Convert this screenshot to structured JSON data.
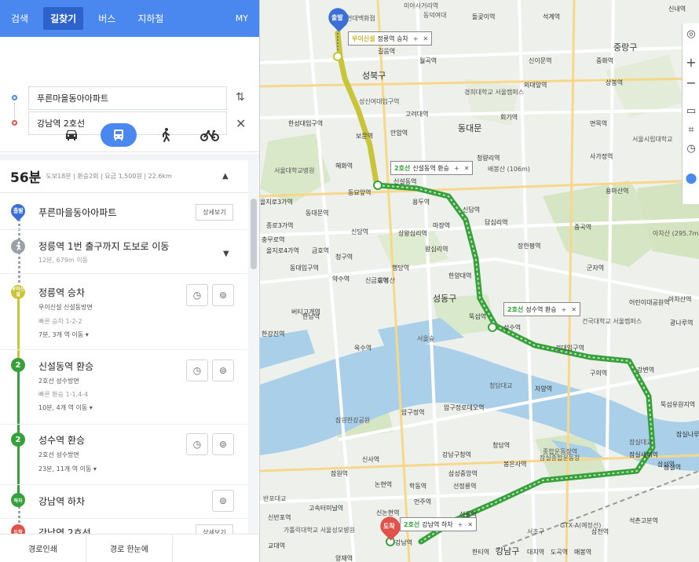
{
  "nav": {
    "tabs": [
      {
        "label": "검색"
      },
      {
        "label": "길찾기"
      },
      {
        "label": "버스"
      },
      {
        "label": "지하철"
      },
      {
        "label": "MY"
      }
    ],
    "active_tab": "길찾기"
  },
  "route_input": {
    "origin": "푸른마을동아아파트",
    "destination": "강남역 2호선",
    "swap_icon": "swap-icon",
    "clear_icon": "close-icon"
  },
  "transport_modes": [
    "car-icon",
    "bus-icon",
    "walk-icon",
    "bike-icon"
  ],
  "active_mode": "bus-icon",
  "summary": {
    "time": "56분",
    "detail": "도보18분 | 환승2회 | 요금 1,500원 | 22.6km"
  },
  "steps": [
    {
      "marker": "출발",
      "title": "푸른마을동아아파트",
      "detail_button": "상세보기"
    },
    {
      "title": "정릉역 1번 출구까지 도보로 이동",
      "sub": "12분, 679m 이동"
    },
    {
      "marker": "우이신설",
      "title": "정릉역 승차",
      "line": "우이신설 신설동방면",
      "car": "빠른 승차 1-2-2",
      "duration": "7분, 3개 역 이동 ▾"
    },
    {
      "marker": "2",
      "title": "신설동역 환승",
      "line": "2호선 성수방면",
      "car": "빠른 환승 1-1,4-4",
      "duration": "10분, 4개 역 이동 ▾"
    },
    {
      "marker": "2",
      "title": "성수역 환승",
      "line": "2호선 성수방면",
      "duration": "23분, 11개 역 이동 ▾"
    },
    {
      "marker": "하차",
      "title": "강남역 하차"
    },
    {
      "marker": "도착",
      "title": "강남역 2호선",
      "detail_button": "상세보기"
    }
  ],
  "footer": {
    "print": "경로인쇄",
    "guide": "경로 한눈에"
  },
  "colors": {
    "brand_blue": "#4a87ee",
    "line_yellow": "#c9c53b",
    "line_green": "#36a13b",
    "origin_pin": "#3b6fd8",
    "dest_pin": "#e0534a"
  },
  "map": {
    "pins": [
      {
        "label": "출발"
      },
      {
        "label": "도착"
      }
    ],
    "route_tags": [
      {
        "line": "우이신설",
        "text": "정릉역 승차"
      },
      {
        "line": "2호선",
        "text": "신설동역 환승"
      },
      {
        "line": "2호선",
        "text": "성수역 환승"
      },
      {
        "line": "2호선",
        "text": "강남역 하차"
      }
    ],
    "districts": [
      "성북구",
      "동대문구",
      "중랑구",
      "성동구",
      "강남구",
      "동대문"
    ],
    "labels": [
      "현대백화점",
      "동덕여대",
      "미아사거리역",
      "길음역",
      "월곡역",
      "돌곶이역",
      "석계역",
      "신내역",
      "경희대학교 서울캠퍼스",
      "성신여대입구역",
      "고려대역",
      "한성대입구역",
      "보문역",
      "안암역",
      "신이문역",
      "외대앞역",
      "회기역",
      "중화역",
      "상봉역",
      "면목역",
      "서울시립대학교",
      "청량리역",
      "사가정역",
      "서울대학교병원",
      "혜화역",
      "동묘앞역",
      "신설동역",
      "용두역",
      "신답역",
      "답십리역",
      "장한평역",
      "용마산역",
      "아차산 (295.7m)",
      "중곡역",
      "군자역",
      "을지로3가역",
      "신당역",
      "상왕십리역",
      "왕십리역",
      "마장역",
      "행당역",
      "한양대역",
      "응봉산",
      "뚝섬역",
      "성수역",
      "건국대학교 서울캠퍼스",
      "건대입구역",
      "어린이대공원역",
      "아차산역",
      "광나루역",
      "구의역",
      "강변역",
      "자양역",
      "뚝섬유원지역",
      "청담역",
      "청담대교",
      "압구정로데오역",
      "압구정역",
      "한남역",
      "옥수역",
      "서울숲",
      "잠원한강공원",
      "신사역",
      "잠원역",
      "논현역",
      "학동역",
      "강남구청역",
      "삼성중앙역",
      "봉은사역",
      "선정릉역",
      "종합운동장역",
      "잠실새내역",
      "반포대교",
      "고속터미널역",
      "신논현역",
      "언주역",
      "선릉역",
      "삼성역",
      "대치역",
      "도곡역",
      "매봉역",
      "한티역",
      "양재역",
      "교대역",
      "서초구",
      "강남역",
      "동대입구역",
      "약수역",
      "신금호역",
      "버티고개역",
      "금호역",
      "동대문역",
      "청구역",
      "배봉산 (106m)",
      "종로3가역",
      "을지로4가역",
      "충무로역",
      "한강진역",
      "잠실대교",
      "잠실종합운동장",
      "석촌고분역",
      "삼전역",
      "GTX-A(예정선)",
      "가톨릭대학교 서울성모병원",
      "신반포역",
      "잠실나루역",
      "잠실역"
    ]
  },
  "map_controls": [
    "locate-icon",
    "zoom-in-icon",
    "zoom-out-icon",
    "layers-icon",
    "measure-icon",
    "clock-icon",
    "pin-icon"
  ]
}
